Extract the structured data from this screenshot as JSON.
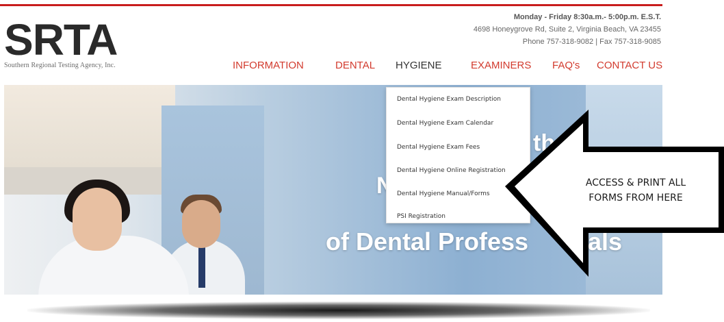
{
  "header": {
    "logo": {
      "mark": "SRTA",
      "subtitle": "Southern Regional Testing Agency, Inc."
    },
    "contact": {
      "hours": "Monday - Friday 8:30a.m.- 5:00p.m. E.S.T.",
      "address": "4698 Honeygrove Rd, Suite 2, Virginia Beach, VA 23455",
      "phone": "Phone 757-318-9082 | Fax 757-318-9085"
    }
  },
  "nav": {
    "items": [
      {
        "label": "INFORMATION"
      },
      {
        "label": "DENTAL"
      },
      {
        "label": "HYGIENE"
      },
      {
        "label": "EXAMINERS"
      },
      {
        "label": "FAQ's"
      },
      {
        "label": "CONTACT US"
      }
    ]
  },
  "dropdown": {
    "items": [
      {
        "label": "Dental Hygiene Exam Description"
      },
      {
        "label": "Dental Hygiene Exam Calendar"
      },
      {
        "label": "Dental Hygiene Exam Fees"
      },
      {
        "label": "Dental Hygiene Online Registration"
      },
      {
        "label": "Dental Hygiene Manual/Forms"
      },
      {
        "label": "PSI Registration"
      }
    ]
  },
  "hero": {
    "text_fragments": {
      "a": "th",
      "b": "N",
      "c": "of Dental Profess",
      "d": "als"
    }
  },
  "callout": {
    "line1": "ACCESS & PRINT ALL",
    "line2": "FORMS FROM HERE"
  },
  "colors": {
    "accent": "#c81d1d",
    "nav_text": "#d23a2d",
    "nav_active": "#333333"
  },
  "icons": {
    "callout_arrow": "left-arrow-icon"
  }
}
